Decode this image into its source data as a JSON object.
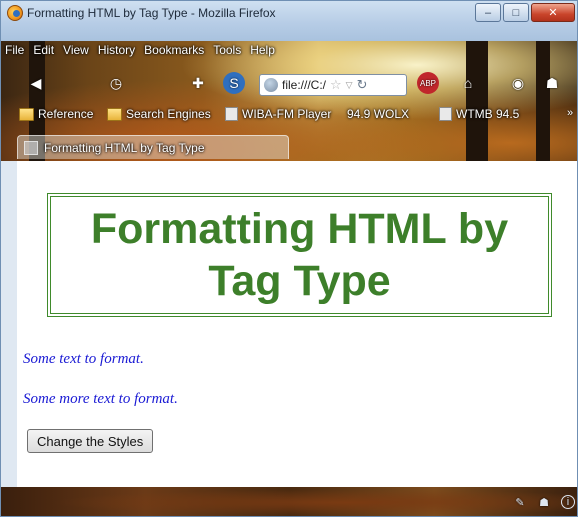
{
  "window": {
    "title": "Formatting HTML by Tag Type - Mozilla Firefox",
    "buttons": {
      "minimize": "–",
      "maximize": "□",
      "close": "✕"
    }
  },
  "menu": [
    "File",
    "Edit",
    "View",
    "History",
    "Bookmarks",
    "Tools",
    "Help"
  ],
  "navbar": {
    "url": "file:///C:/",
    "icons": [
      "back-icon",
      "history-icon",
      "add-icon",
      "s-icon",
      "abp-icon",
      "home-icon",
      "eye-icon",
      "ghost-icon"
    ]
  },
  "bookmarks": [
    {
      "label": "Reference",
      "icon": "folder-icon"
    },
    {
      "label": "Search Engines",
      "icon": "folder-icon"
    },
    {
      "label": "WIBA-FM Player",
      "icon": "page-icon"
    },
    {
      "label": "94.9 WOLX",
      "icon": "page-icon"
    },
    {
      "label": "WTMB 94.5",
      "icon": "page-icon"
    }
  ],
  "tab": {
    "label": "Formatting HTML by Tag Type"
  },
  "page": {
    "heading_line1": "Formatting HTML by",
    "heading_line2": "Tag Type",
    "para1": "Some text to format.",
    "para2": "Some more text to format.",
    "button": "Change the Styles"
  },
  "colors": {
    "heading": "#3d7f2a",
    "heading_border": "#3f8a2b",
    "paragraph_text": "#1a1ad4"
  }
}
